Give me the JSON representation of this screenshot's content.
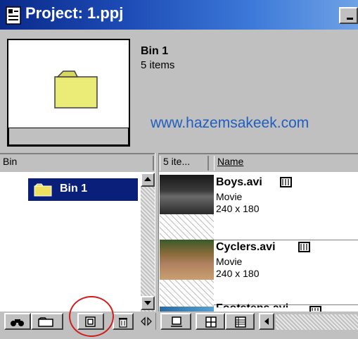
{
  "window": {
    "title": "Project: 1.ppj"
  },
  "header": {
    "bin_name": "Bin 1",
    "item_count": "5 items",
    "watermark": "www.hazemsakeek.com"
  },
  "columns": {
    "bin": "Bin",
    "size": "5 ite...",
    "name": "Name"
  },
  "bins": [
    {
      "label": "Bin 1",
      "selected": true
    }
  ],
  "clips": [
    {
      "name": "Boys.avi",
      "type": "Movie",
      "dimensions": "240 x 180"
    },
    {
      "name": "Cyclers.avi",
      "type": "Movie",
      "dimensions": "240 x 180"
    },
    {
      "name": "Footsteps.avi",
      "type": "",
      "dimensions": ""
    }
  ],
  "toolbar": {
    "icons": [
      "find-icon",
      "new-bin-icon",
      "new-item-icon",
      "delete-icon",
      "pane-toggle-icon",
      "thumbnail-view-icon",
      "icon-view-icon",
      "list-view-icon",
      "scroll-left-icon"
    ]
  },
  "colors": {
    "title_bar": "#0a2a8a",
    "selection": "#0a1f7a",
    "highlight_circle": "#d11c1c",
    "watermark": "#1f5fbf"
  }
}
